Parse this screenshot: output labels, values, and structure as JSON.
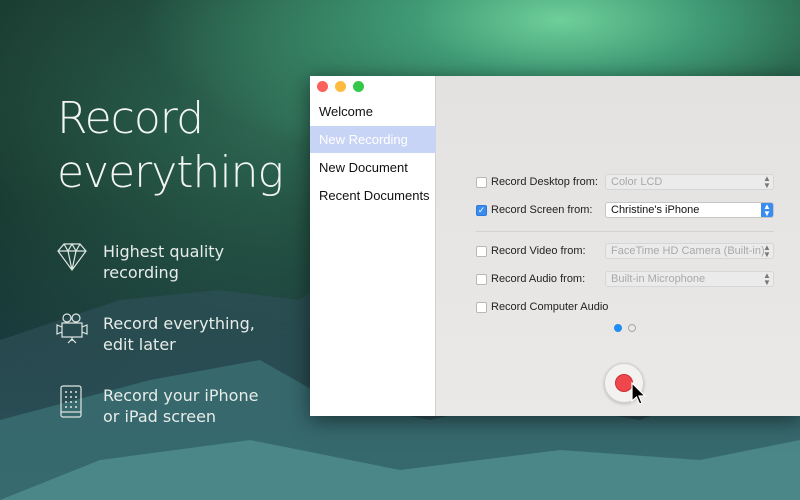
{
  "hero": {
    "line1": "Record",
    "line2": "everything"
  },
  "features": [
    {
      "icon": "diamond-icon",
      "line1": "Highest quality",
      "line2": "recording"
    },
    {
      "icon": "movie-camera-icon",
      "line1": "Record everything,",
      "line2": "edit later"
    },
    {
      "icon": "tablet-icon",
      "line1": "Record your iPhone",
      "line2": "or iPad screen"
    }
  ],
  "sidebar": {
    "items": [
      {
        "label": "Welcome"
      },
      {
        "label": "New Recording",
        "selected": true
      },
      {
        "label": "New Document"
      },
      {
        "label": "Recent Documents"
      }
    ]
  },
  "options": [
    {
      "label": "Record Desktop from:",
      "checked": false,
      "value": "Color LCD"
    },
    {
      "label": "Record Screen from:",
      "checked": true,
      "value": "Christine's iPhone"
    },
    {
      "label": "Record Video from:",
      "checked": false,
      "value": "FaceTime HD Camera (Built-in)"
    },
    {
      "label": "Record Audio from:",
      "checked": false,
      "value": "Built-in Microphone"
    },
    {
      "label": "Record Computer Audio",
      "checked": false
    }
  ],
  "pager": {
    "current": 1,
    "total": 2
  },
  "colors": {
    "accent": "#3b8cf2",
    "record": "#f0474d",
    "selection": "#c8d4f6"
  }
}
